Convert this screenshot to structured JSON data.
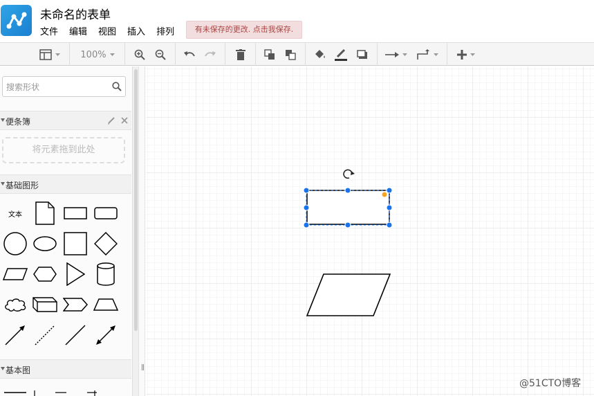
{
  "header": {
    "title": "未命名的表单",
    "menus": [
      "文件",
      "编辑",
      "视图",
      "插入",
      "排列"
    ],
    "unsaved_notice": "有未保存的更改. 点击我保存."
  },
  "toolbar": {
    "zoom": "100%"
  },
  "sidebar": {
    "search_placeholder": "搜索形状",
    "scratchpad_title": "便条簿",
    "drop_hint": "将元素拖到此处",
    "basic_shapes_title": "基础图形",
    "text_shape_label": "文本",
    "basic_diagram_title": "基本图"
  },
  "watermark": "@51CTO博客",
  "colors": {
    "accent": "#1a73e8",
    "handle": "#1a73e8",
    "handle_orange": "#f5a623",
    "notice_bg": "#f2dede",
    "notice_text": "#a94442"
  }
}
